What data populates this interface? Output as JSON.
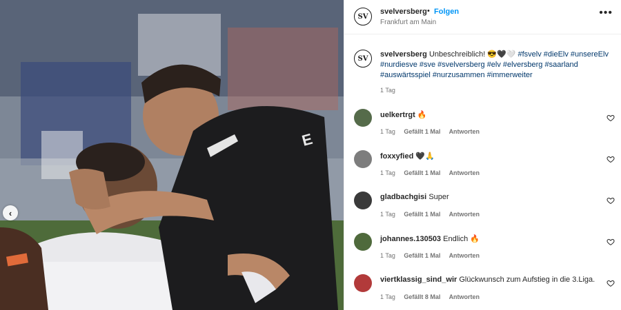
{
  "post": {
    "username": "svelversberg",
    "follow_label": "Folgen",
    "location": "Frankfurt am Main",
    "avatar_text": "SV",
    "more_label": "•••"
  },
  "caption": {
    "username": "svelversberg",
    "text": "Unbeschreiblich! 😎🖤🤍",
    "hashtags": "#fsvelv #dieElv #unsereElv #nurdiesve #sve #svelversberg #elv #elversberg #saarland #auswärtsspiel #nurzusammen #immerweiter",
    "age": "1 Tag"
  },
  "comments": [
    {
      "username": "uelkertrgt",
      "text": "🔥",
      "age": "1 Tag",
      "likes": "Gefällt 1 Mal",
      "reply": "Antworten",
      "avatar_color": "#556b4a"
    },
    {
      "username": "foxxyfied",
      "text": "🖤🙏",
      "age": "1 Tag",
      "likes": "Gefällt 1 Mal",
      "reply": "Antworten",
      "avatar_color": "#7d7d7d"
    },
    {
      "username": "gladbachgisi",
      "text": "Super",
      "age": "1 Tag",
      "likes": "Gefällt 1 Mal",
      "reply": "Antworten",
      "avatar_color": "#3a3a3a"
    },
    {
      "username": "johannes.130503",
      "text": "Endlich 🔥",
      "age": "1 Tag",
      "likes": "Gefällt 1 Mal",
      "reply": "Antworten",
      "avatar_color": "#4f6a3c"
    },
    {
      "username": "viertklassig_sind_wir",
      "text": "Glückwunsch zum Aufstieg in die 3.Liga.",
      "age": "1 Tag",
      "likes": "Gefällt 8 Mal",
      "reply": "Antworten",
      "avatar_color": "#b23a3a"
    }
  ],
  "carousel": {
    "prev_label": "‹"
  },
  "colors": {
    "link": "#0095f6",
    "hashtag": "#00376b",
    "muted": "#737373"
  }
}
